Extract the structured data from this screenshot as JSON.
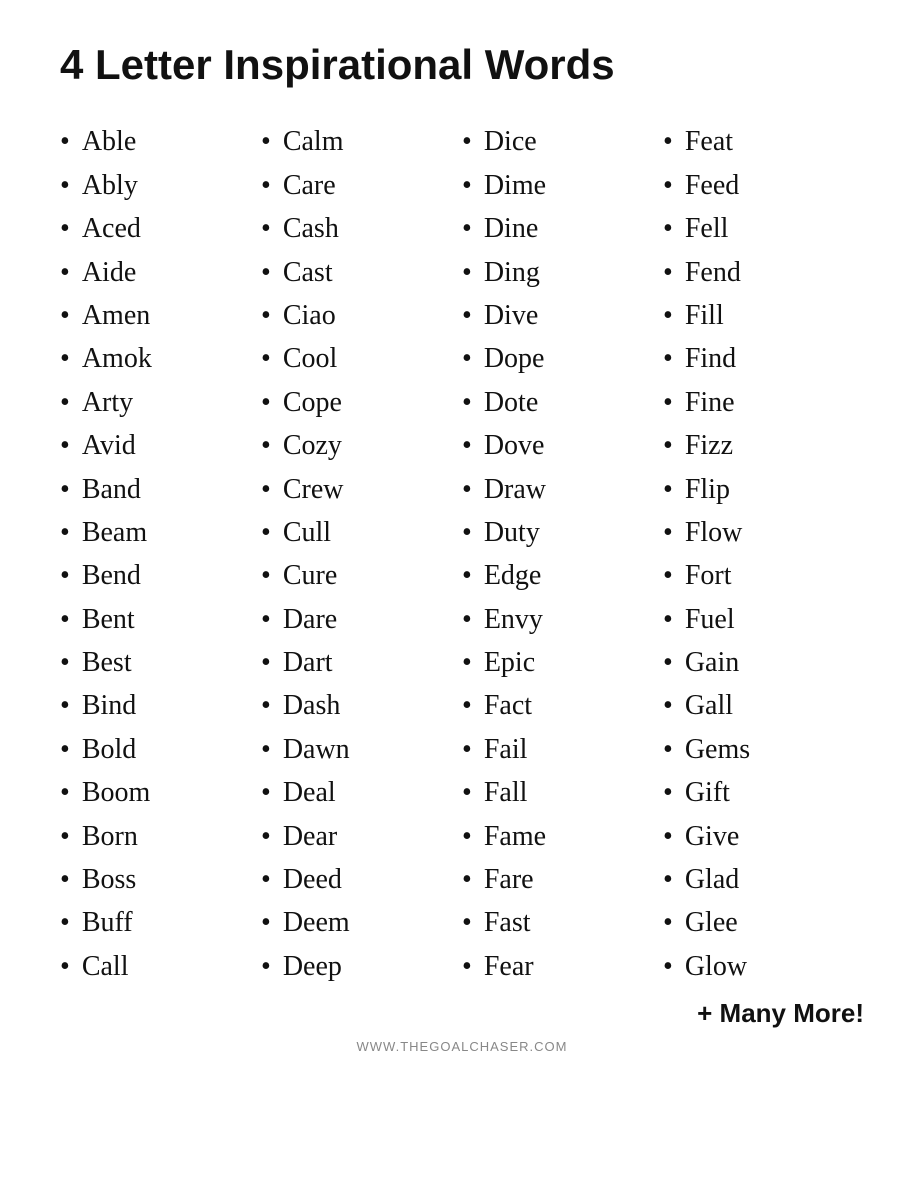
{
  "title": "4 Letter Inspirational Words",
  "columns": [
    {
      "id": "col1",
      "words": [
        "Able",
        "Ably",
        "Aced",
        "Aide",
        "Amen",
        "Amok",
        "Arty",
        "Avid",
        "Band",
        "Beam",
        "Bend",
        "Bent",
        "Best",
        "Bind",
        "Bold",
        "Boom",
        "Born",
        "Boss",
        "Buff",
        "Call"
      ]
    },
    {
      "id": "col2",
      "words": [
        "Calm",
        "Care",
        "Cash",
        "Cast",
        "Ciao",
        "Cool",
        "Cope",
        "Cozy",
        "Crew",
        "Cull",
        "Cure",
        "Dare",
        "Dart",
        "Dash",
        "Dawn",
        "Deal",
        "Dear",
        "Deed",
        "Deem",
        "Deep"
      ]
    },
    {
      "id": "col3",
      "words": [
        "Dice",
        "Dime",
        "Dine",
        "Ding",
        "Dive",
        "Dope",
        "Dote",
        "Dove",
        "Draw",
        "Duty",
        "Edge",
        "Envy",
        "Epic",
        "Fact",
        "Fail",
        "Fall",
        "Fame",
        "Fare",
        "Fast",
        "Fear"
      ]
    },
    {
      "id": "col4",
      "words": [
        "Feat",
        "Feed",
        "Fell",
        "Fend",
        "Fill",
        "Find",
        "Fine",
        "Fizz",
        "Flip",
        "Flow",
        "Fort",
        "Fuel",
        "Gain",
        "Gall",
        "Gems",
        "Gift",
        "Give",
        "Glad",
        "Glee",
        "Glow"
      ]
    }
  ],
  "many_more": "+ Many More!",
  "website": "WWW.THEGOALCHASER.COM"
}
